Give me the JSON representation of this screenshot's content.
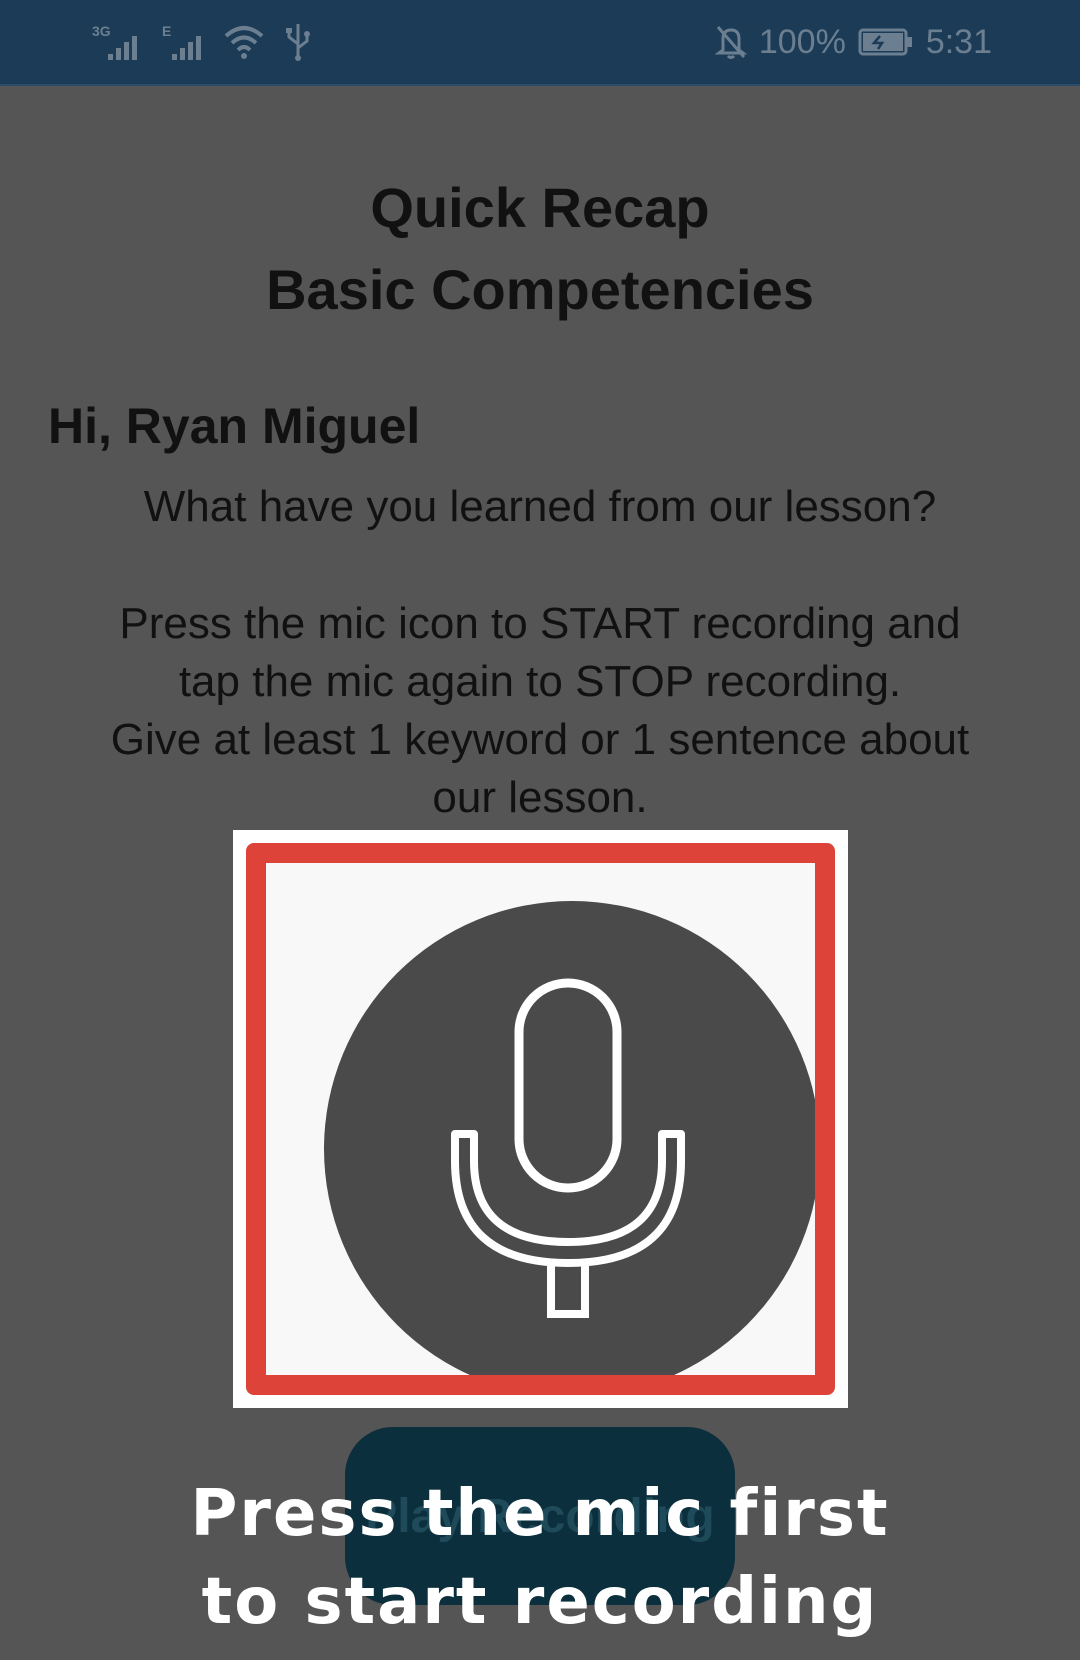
{
  "status_bar": {
    "network_1": "3G",
    "network_2": "E",
    "battery": "100%",
    "time": "5:31",
    "icons": [
      "signal-3g-icon",
      "signal-e-icon",
      "wifi-icon",
      "usb-icon",
      "bell-off-icon",
      "battery-charging-icon"
    ]
  },
  "header": {
    "title_line1": "Quick Recap",
    "title_line2": "Basic Competencies"
  },
  "greeting": "Hi, Ryan Miguel",
  "question": "What have you learned from our lesson?",
  "instructions": [
    "Press the mic icon to START recording and",
    "tap the mic again to STOP recording.",
    "Give at least 1 keyword or 1 sentence about",
    "our lesson."
  ],
  "mic": {
    "icon": "microphone-icon",
    "highlight_color": "#dd4339"
  },
  "play_button": {
    "label": "Play Recording"
  },
  "overlay": {
    "line1": "Press the mic first",
    "line2": "to start recording"
  }
}
